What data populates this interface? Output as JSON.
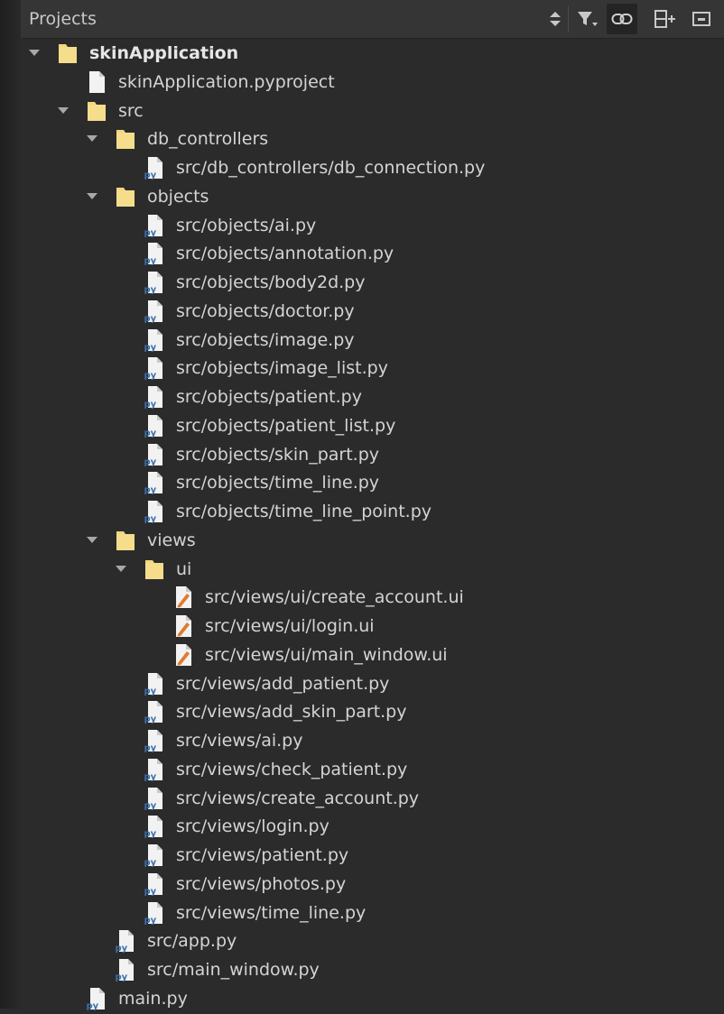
{
  "panel": {
    "title": "Projects",
    "toolbar": [
      {
        "name": "sort-icon",
        "label": ""
      },
      {
        "name": "filter-icon",
        "label": ""
      },
      {
        "name": "link-icon",
        "label": ""
      },
      {
        "name": "split-add-icon",
        "label": ""
      },
      {
        "name": "close-panel-icon",
        "label": ""
      }
    ]
  },
  "tree": [
    {
      "depth": 0,
      "kind": "folder",
      "expanded": true,
      "label": "skinApplication",
      "bold": true
    },
    {
      "depth": 1,
      "kind": "file",
      "label": "skinApplication.pyproject"
    },
    {
      "depth": 1,
      "kind": "folder",
      "expanded": true,
      "label": "src"
    },
    {
      "depth": 2,
      "kind": "folder",
      "expanded": true,
      "label": "db_controllers"
    },
    {
      "depth": 3,
      "kind": "py",
      "label": "src/db_controllers/db_connection.py"
    },
    {
      "depth": 2,
      "kind": "folder",
      "expanded": true,
      "label": "objects"
    },
    {
      "depth": 3,
      "kind": "py",
      "label": "src/objects/ai.py"
    },
    {
      "depth": 3,
      "kind": "py",
      "label": "src/objects/annotation.py"
    },
    {
      "depth": 3,
      "kind": "py",
      "label": "src/objects/body2d.py"
    },
    {
      "depth": 3,
      "kind": "py",
      "label": "src/objects/doctor.py"
    },
    {
      "depth": 3,
      "kind": "py",
      "label": "src/objects/image.py"
    },
    {
      "depth": 3,
      "kind": "py",
      "label": "src/objects/image_list.py"
    },
    {
      "depth": 3,
      "kind": "py",
      "label": "src/objects/patient.py"
    },
    {
      "depth": 3,
      "kind": "py",
      "label": "src/objects/patient_list.py"
    },
    {
      "depth": 3,
      "kind": "py",
      "label": "src/objects/skin_part.py"
    },
    {
      "depth": 3,
      "kind": "py",
      "label": "src/objects/time_line.py"
    },
    {
      "depth": 3,
      "kind": "py",
      "label": "src/objects/time_line_point.py"
    },
    {
      "depth": 2,
      "kind": "folder",
      "expanded": true,
      "label": "views"
    },
    {
      "depth": 3,
      "kind": "folder",
      "expanded": true,
      "label": "ui"
    },
    {
      "depth": 4,
      "kind": "ui",
      "label": "src/views/ui/create_account.ui"
    },
    {
      "depth": 4,
      "kind": "ui",
      "label": "src/views/ui/login.ui"
    },
    {
      "depth": 4,
      "kind": "ui",
      "label": "src/views/ui/main_window.ui"
    },
    {
      "depth": 3,
      "kind": "py",
      "label": "src/views/add_patient.py"
    },
    {
      "depth": 3,
      "kind": "py",
      "label": "src/views/add_skin_part.py"
    },
    {
      "depth": 3,
      "kind": "py",
      "label": "src/views/ai.py"
    },
    {
      "depth": 3,
      "kind": "py",
      "label": "src/views/check_patient.py"
    },
    {
      "depth": 3,
      "kind": "py",
      "label": "src/views/create_account.py"
    },
    {
      "depth": 3,
      "kind": "py",
      "label": "src/views/login.py"
    },
    {
      "depth": 3,
      "kind": "py",
      "label": "src/views/patient.py"
    },
    {
      "depth": 3,
      "kind": "py",
      "label": "src/views/photos.py"
    },
    {
      "depth": 3,
      "kind": "py",
      "label": "src/views/time_line.py"
    },
    {
      "depth": 2,
      "kind": "py",
      "label": "src/app.py"
    },
    {
      "depth": 2,
      "kind": "py",
      "label": "src/main_window.py"
    },
    {
      "depth": 1,
      "kind": "py",
      "label": "main.py"
    }
  ],
  "colors": {
    "background": "#2b2b2c",
    "header": "#353536",
    "text": "#d4d4d4",
    "folder": "#f3d67e",
    "py_badge": "#3b6ea8",
    "ui_pencil": "#e07a2f"
  }
}
